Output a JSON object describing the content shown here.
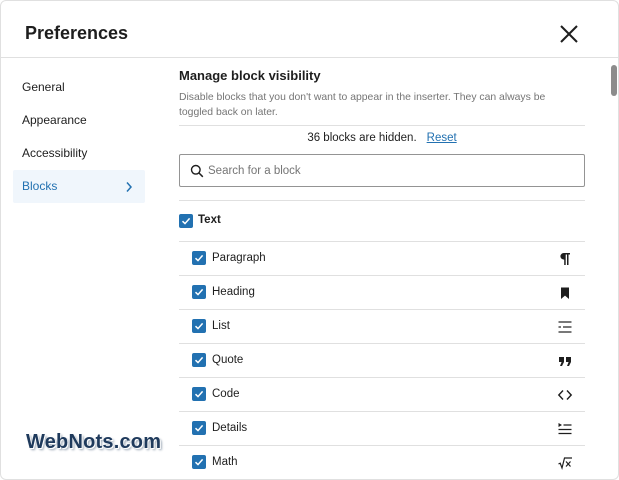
{
  "dialog": {
    "title": "Preferences",
    "close_icon": "close-x-icon"
  },
  "sidebar": {
    "items": [
      {
        "label": "General",
        "active": false
      },
      {
        "label": "Appearance",
        "active": false
      },
      {
        "label": "Accessibility",
        "active": false
      },
      {
        "label": "Blocks",
        "active": true,
        "icon": "chevron-right-icon"
      }
    ]
  },
  "blocks_panel": {
    "title": "Manage block visibility",
    "description": "Disable blocks that you don't want to appear in the inserter. They can always be toggled back on later.",
    "hidden_count_text": "36 blocks are hidden.",
    "reset_label": "Reset",
    "search": {
      "placeholder": "Search for a block",
      "value": "",
      "icon": "search-icon"
    },
    "category": {
      "label": "Text",
      "checked": true
    },
    "blocks": [
      {
        "label": "Paragraph",
        "checked": true,
        "icon": "paragraph-icon"
      },
      {
        "label": "Heading",
        "checked": true,
        "icon": "bookmark-icon"
      },
      {
        "label": "List",
        "checked": true,
        "icon": "list-icon"
      },
      {
        "label": "Quote",
        "checked": true,
        "icon": "quote-icon"
      },
      {
        "label": "Code",
        "checked": true,
        "icon": "code-icon"
      },
      {
        "label": "Details",
        "checked": true,
        "icon": "details-icon"
      },
      {
        "label": "Math",
        "checked": true,
        "icon": "math-icon"
      }
    ]
  },
  "watermark": {
    "text": "WebNots.com"
  },
  "colors": {
    "accent": "#2271b1",
    "active_nav_bg": "#f0f6fc",
    "text": "#1e1e1e",
    "muted_text": "#757575",
    "border": "#e0e0e0"
  }
}
